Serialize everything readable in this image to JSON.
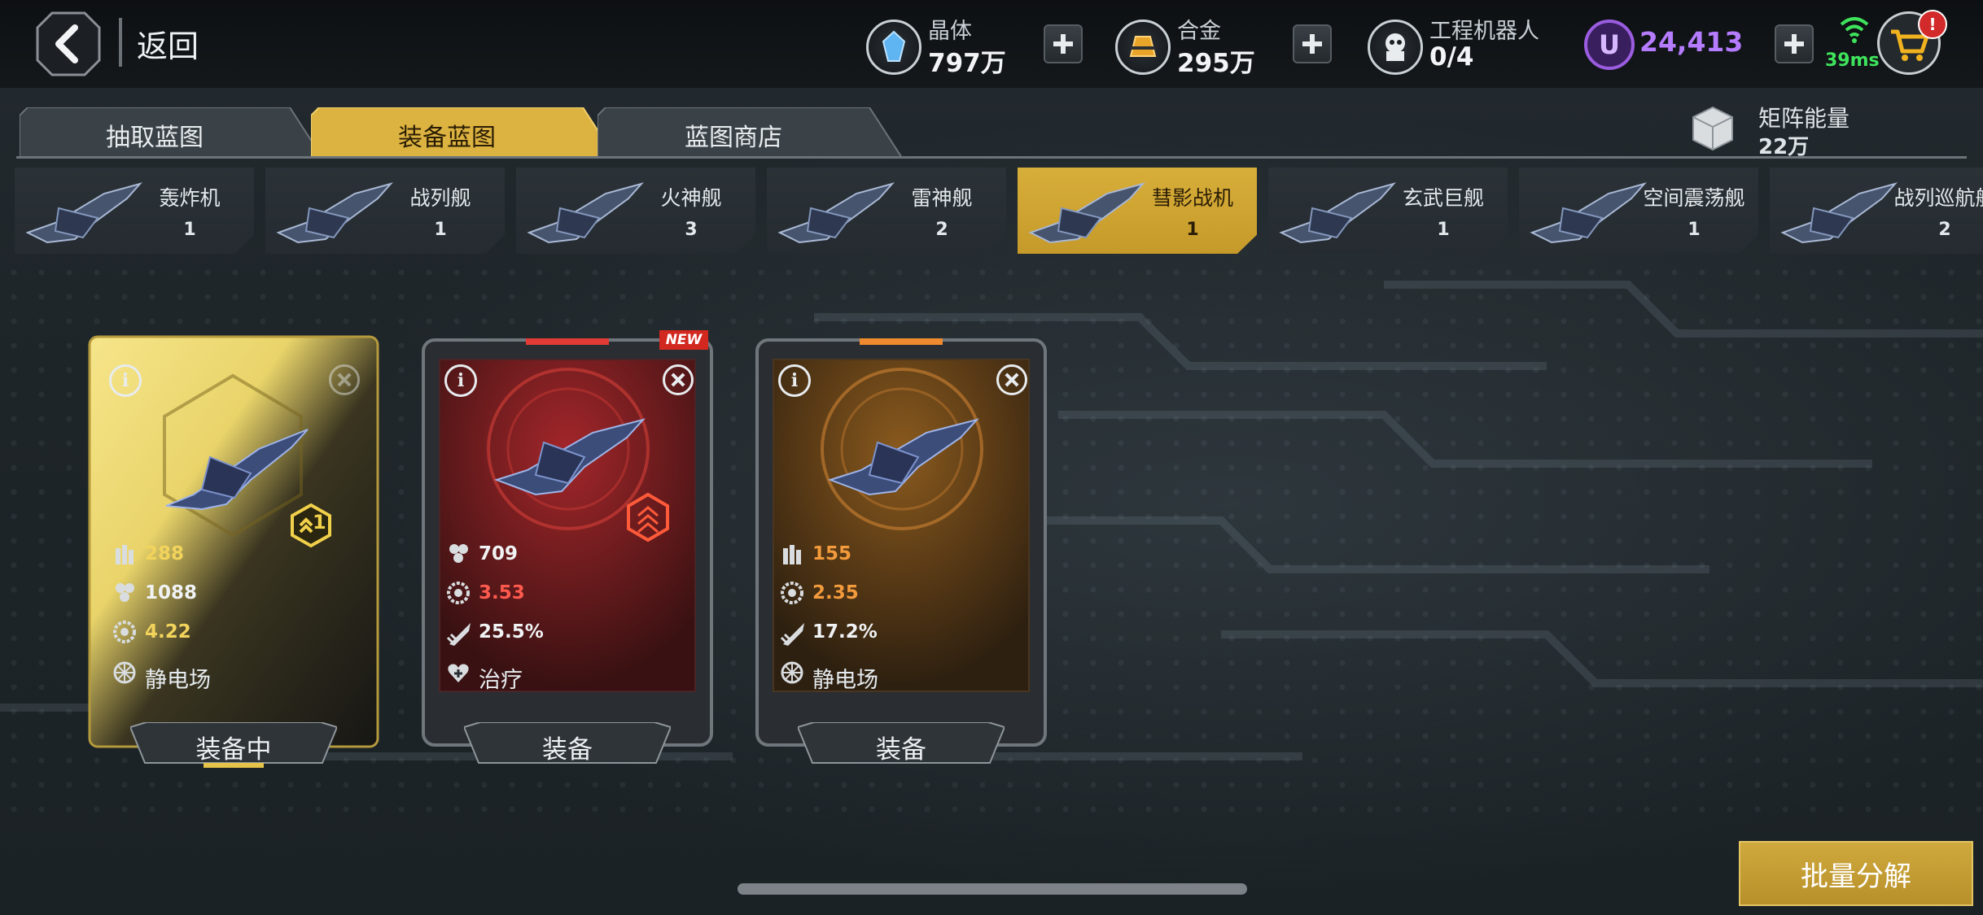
{
  "header": {
    "back_label": "返回",
    "resources": [
      {
        "name": "晶体",
        "value": "797万",
        "icon": "crystal-icon"
      },
      {
        "name": "合金",
        "value": "295万",
        "icon": "alloy-icon"
      },
      {
        "name": "工程机器人",
        "value": "0/4",
        "icon": "robot-icon"
      }
    ],
    "currency": {
      "symbol": "U",
      "value": "24,413",
      "color": "#b67cff"
    },
    "ping": "39ms",
    "cart_badge": "!"
  },
  "tabs": [
    {
      "label": "抽取蓝图",
      "active": false
    },
    {
      "label": "装备蓝图",
      "active": true
    },
    {
      "label": "蓝图商店",
      "active": false
    }
  ],
  "matrix_energy": {
    "name": "矩阵能量",
    "value": "22万"
  },
  "categories": [
    {
      "name": "轰炸机",
      "count": "1",
      "active": false
    },
    {
      "name": "战列舰",
      "count": "1",
      "active": false
    },
    {
      "name": "火神舰",
      "count": "3",
      "active": false
    },
    {
      "name": "雷神舰",
      "count": "2",
      "active": false
    },
    {
      "name": "彗影战机",
      "count": "1",
      "active": true
    },
    {
      "name": "玄武巨舰",
      "count": "1",
      "active": false
    },
    {
      "name": "空间震荡舰",
      "count": "1",
      "active": false
    },
    {
      "name": "战列巡航舰",
      "count": "2",
      "active": false
    }
  ],
  "cards": [
    {
      "theme": "gold",
      "info": "i",
      "level": "1",
      "stats": [
        {
          "icon": "ammo-icon",
          "value": "288",
          "color": "#f2d45c"
        },
        {
          "icon": "hex-cluster-icon",
          "value": "1088",
          "color": "#f0f2f4"
        },
        {
          "icon": "gear-disc-icon",
          "value": "4.22",
          "color": "#f2d45c"
        }
      ],
      "skill": {
        "icon": "static-field-icon",
        "label": "静电场"
      },
      "button": "装备中"
    },
    {
      "theme": "red",
      "info": "i",
      "new_badge": "NEW",
      "stats": [
        {
          "icon": "hex-cluster-icon",
          "value": "709",
          "color": "#f0f2f4"
        },
        {
          "icon": "gear-disc-icon",
          "value": "3.53",
          "color": "#ff5a4e"
        },
        {
          "icon": "missile-icon",
          "value": "25.5%",
          "color": "#f0f2f4"
        }
      ],
      "skill": {
        "icon": "heal-icon",
        "label": "治疗"
      },
      "button": "装备"
    },
    {
      "theme": "orange",
      "info": "i",
      "stats": [
        {
          "icon": "ammo-icon",
          "value": "155",
          "color": "#f29a3c"
        },
        {
          "icon": "gear-disc-icon",
          "value": "2.35",
          "color": "#f29a3c"
        },
        {
          "icon": "missile-icon",
          "value": "17.2%",
          "color": "#f0f2f4"
        }
      ],
      "skill": {
        "icon": "static-field-icon",
        "label": "静电场"
      },
      "button": "装备"
    }
  ],
  "bulk_button": "批量分解"
}
